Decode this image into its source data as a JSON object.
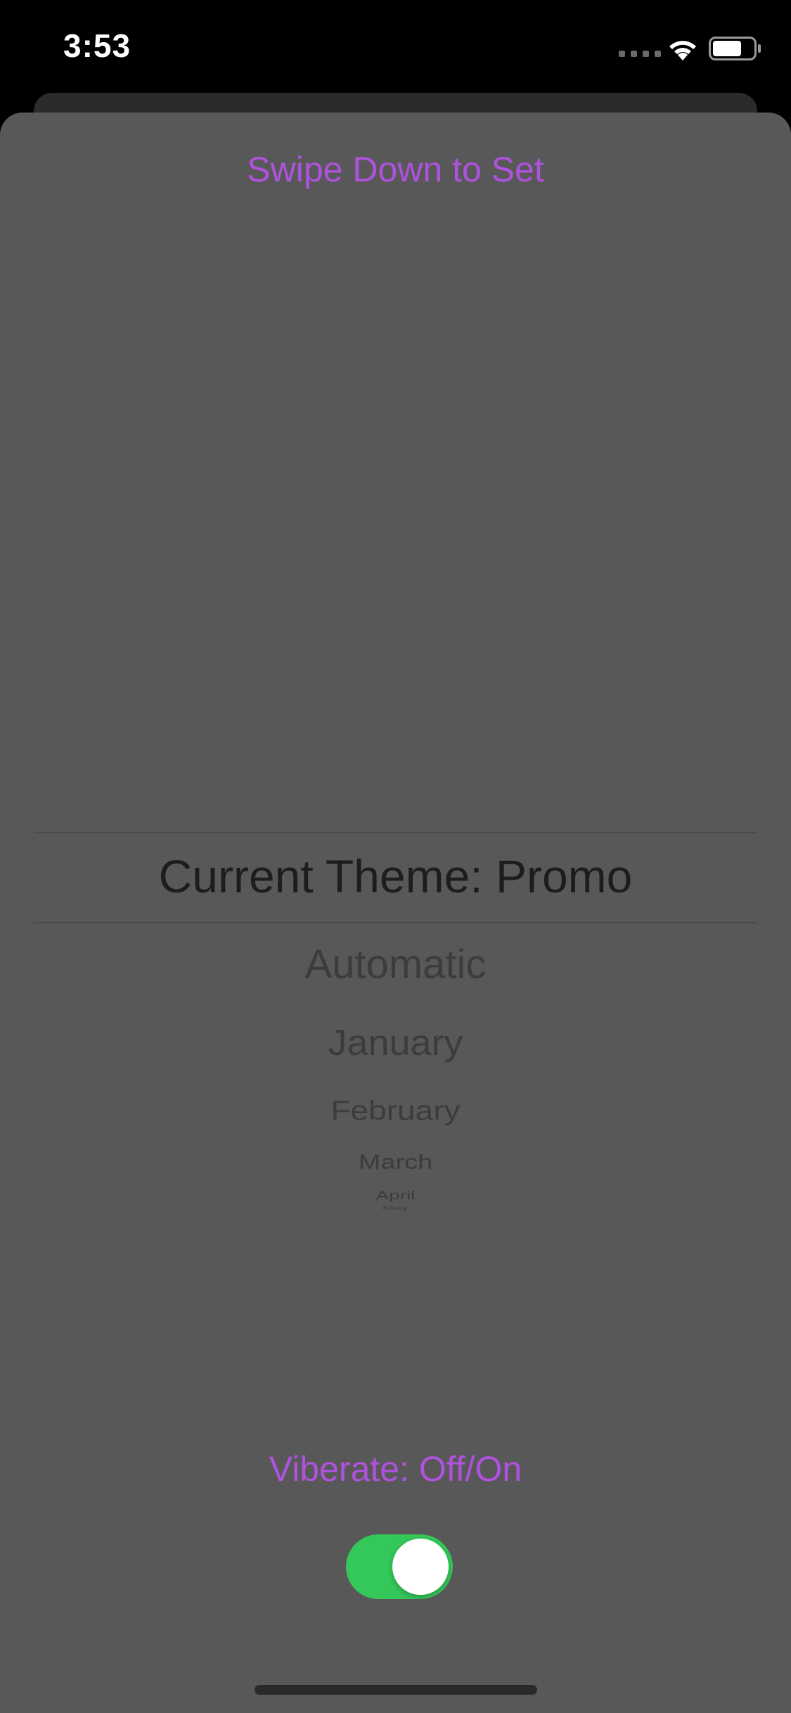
{
  "status_bar": {
    "time": "3:53"
  },
  "sheet": {
    "title": "Swipe Down to Set"
  },
  "theme_picker": {
    "selected": "Current Theme: Promo",
    "options": [
      "Automatic",
      "January",
      "February",
      "March",
      "April",
      "May"
    ]
  },
  "vibrate": {
    "label": "Viberate: Off/On",
    "enabled": true
  },
  "colors": {
    "accent": "#af52de",
    "toggle_on": "#34c759",
    "sheet_bg": "#585858"
  }
}
